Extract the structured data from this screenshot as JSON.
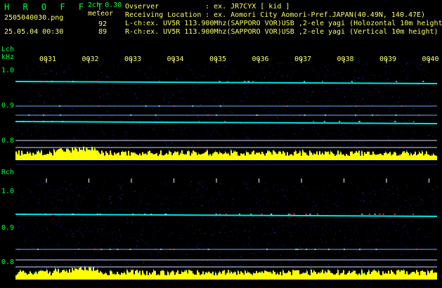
{
  "header": {
    "title": "H R O F F T",
    "channel": "2ch 0.30",
    "mode": "meteor",
    "filename": "2505040030.png",
    "datetime": "25.05.04 00:30",
    "count_l": "92",
    "count_r": "89",
    "observer_label": "Ovserver",
    "observer_value": ": ex. JR7CYX [ kid ]",
    "location_label": "Receiving Location",
    "location_value": ": ex. Aomori City Aomori-Pref.JAPAN(40.49N, 140.47E)",
    "lch_info": "L-ch:ex. UV5R 113.900Mhz(SAPPORO VOR)USB ,2-ele yagi (Holozontal 10m height",
    "rch_info": "R-ch:ex. UV5R 113.900Mhz(SAPPORO VOR)USB ,2-ele yagi (Vertical 10m height)"
  },
  "lch": {
    "label": "Lch",
    "unit": "kHz",
    "yticks": [
      "1.0",
      "0.9",
      "0.8"
    ]
  },
  "rch": {
    "label": "Rch",
    "yticks": [
      "1.0",
      "0.9",
      "0.8"
    ]
  },
  "time_ticks": [
    "0031",
    "0032",
    "0033",
    "0034",
    "0035",
    "0036",
    "0037",
    "0038",
    "0039",
    "0040"
  ],
  "colors": {
    "background": "#000000",
    "title": "#00ff3c",
    "text": "#ffff66",
    "signal": "#ffff00",
    "line": "#00e0ff",
    "noise": "#1a1a8a"
  }
}
